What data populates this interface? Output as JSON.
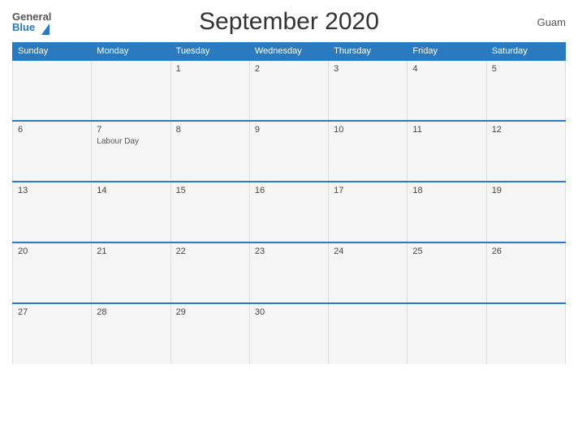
{
  "header": {
    "title": "September 2020",
    "country": "Guam",
    "logo_general": "General",
    "logo_blue": "Blue"
  },
  "weekdays": [
    "Sunday",
    "Monday",
    "Tuesday",
    "Wednesday",
    "Thursday",
    "Friday",
    "Saturday"
  ],
  "weeks": [
    [
      {
        "day": "",
        "event": ""
      },
      {
        "day": "",
        "event": ""
      },
      {
        "day": "1",
        "event": ""
      },
      {
        "day": "2",
        "event": ""
      },
      {
        "day": "3",
        "event": ""
      },
      {
        "day": "4",
        "event": ""
      },
      {
        "day": "5",
        "event": ""
      }
    ],
    [
      {
        "day": "6",
        "event": ""
      },
      {
        "day": "7",
        "event": "Labour Day"
      },
      {
        "day": "8",
        "event": ""
      },
      {
        "day": "9",
        "event": ""
      },
      {
        "day": "10",
        "event": ""
      },
      {
        "day": "11",
        "event": ""
      },
      {
        "day": "12",
        "event": ""
      }
    ],
    [
      {
        "day": "13",
        "event": ""
      },
      {
        "day": "14",
        "event": ""
      },
      {
        "day": "15",
        "event": ""
      },
      {
        "day": "16",
        "event": ""
      },
      {
        "day": "17",
        "event": ""
      },
      {
        "day": "18",
        "event": ""
      },
      {
        "day": "19",
        "event": ""
      }
    ],
    [
      {
        "day": "20",
        "event": ""
      },
      {
        "day": "21",
        "event": ""
      },
      {
        "day": "22",
        "event": ""
      },
      {
        "day": "23",
        "event": ""
      },
      {
        "day": "24",
        "event": ""
      },
      {
        "day": "25",
        "event": ""
      },
      {
        "day": "26",
        "event": ""
      }
    ],
    [
      {
        "day": "27",
        "event": ""
      },
      {
        "day": "28",
        "event": ""
      },
      {
        "day": "29",
        "event": ""
      },
      {
        "day": "30",
        "event": ""
      },
      {
        "day": "",
        "event": ""
      },
      {
        "day": "",
        "event": ""
      },
      {
        "day": "",
        "event": ""
      }
    ]
  ]
}
